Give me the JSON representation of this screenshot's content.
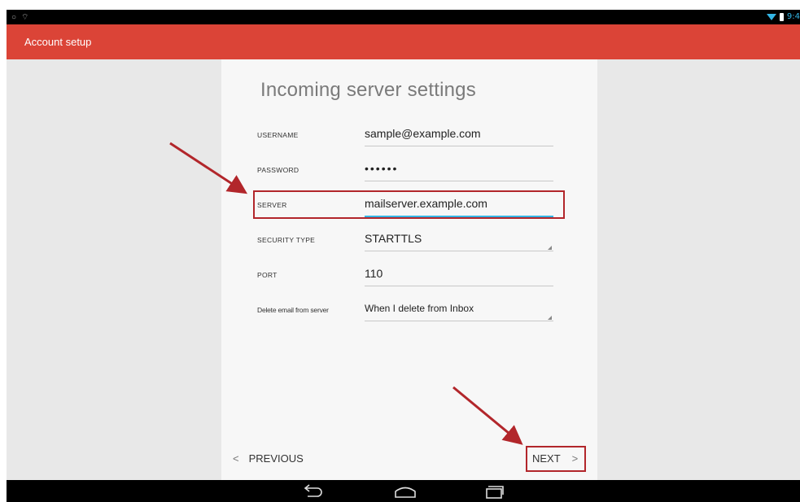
{
  "app": {
    "title": "Account setup",
    "accent_color": "#db4437",
    "highlight_color": "#b2262b",
    "focus_color": "#33b5e5"
  },
  "status_bar": {
    "time": "9:4",
    "icons": [
      "circle-icon",
      "signal-icon",
      "wifi-icon",
      "battery-icon"
    ]
  },
  "form": {
    "heading": "Incoming server settings",
    "fields": [
      {
        "label": "USERNAME",
        "value": "sample@example.com",
        "type": "text"
      },
      {
        "label": "PASSWORD",
        "value": "••••••",
        "type": "password"
      },
      {
        "label": "SERVER",
        "value": "mailserver.example.com",
        "type": "text",
        "focused": true
      },
      {
        "label": "SECURITY TYPE",
        "value": "STARTTLS",
        "type": "select"
      },
      {
        "label": "PORT",
        "value": "110",
        "type": "text"
      },
      {
        "label": "Delete email from server",
        "value": "When I delete from Inbox",
        "type": "select"
      }
    ]
  },
  "footer": {
    "previous_label": "PREVIOUS",
    "previous_icon": "<",
    "next_label": "NEXT",
    "next_icon": ">"
  },
  "nav_bar": {
    "buttons": [
      "back-icon",
      "home-icon",
      "recents-icon"
    ]
  }
}
